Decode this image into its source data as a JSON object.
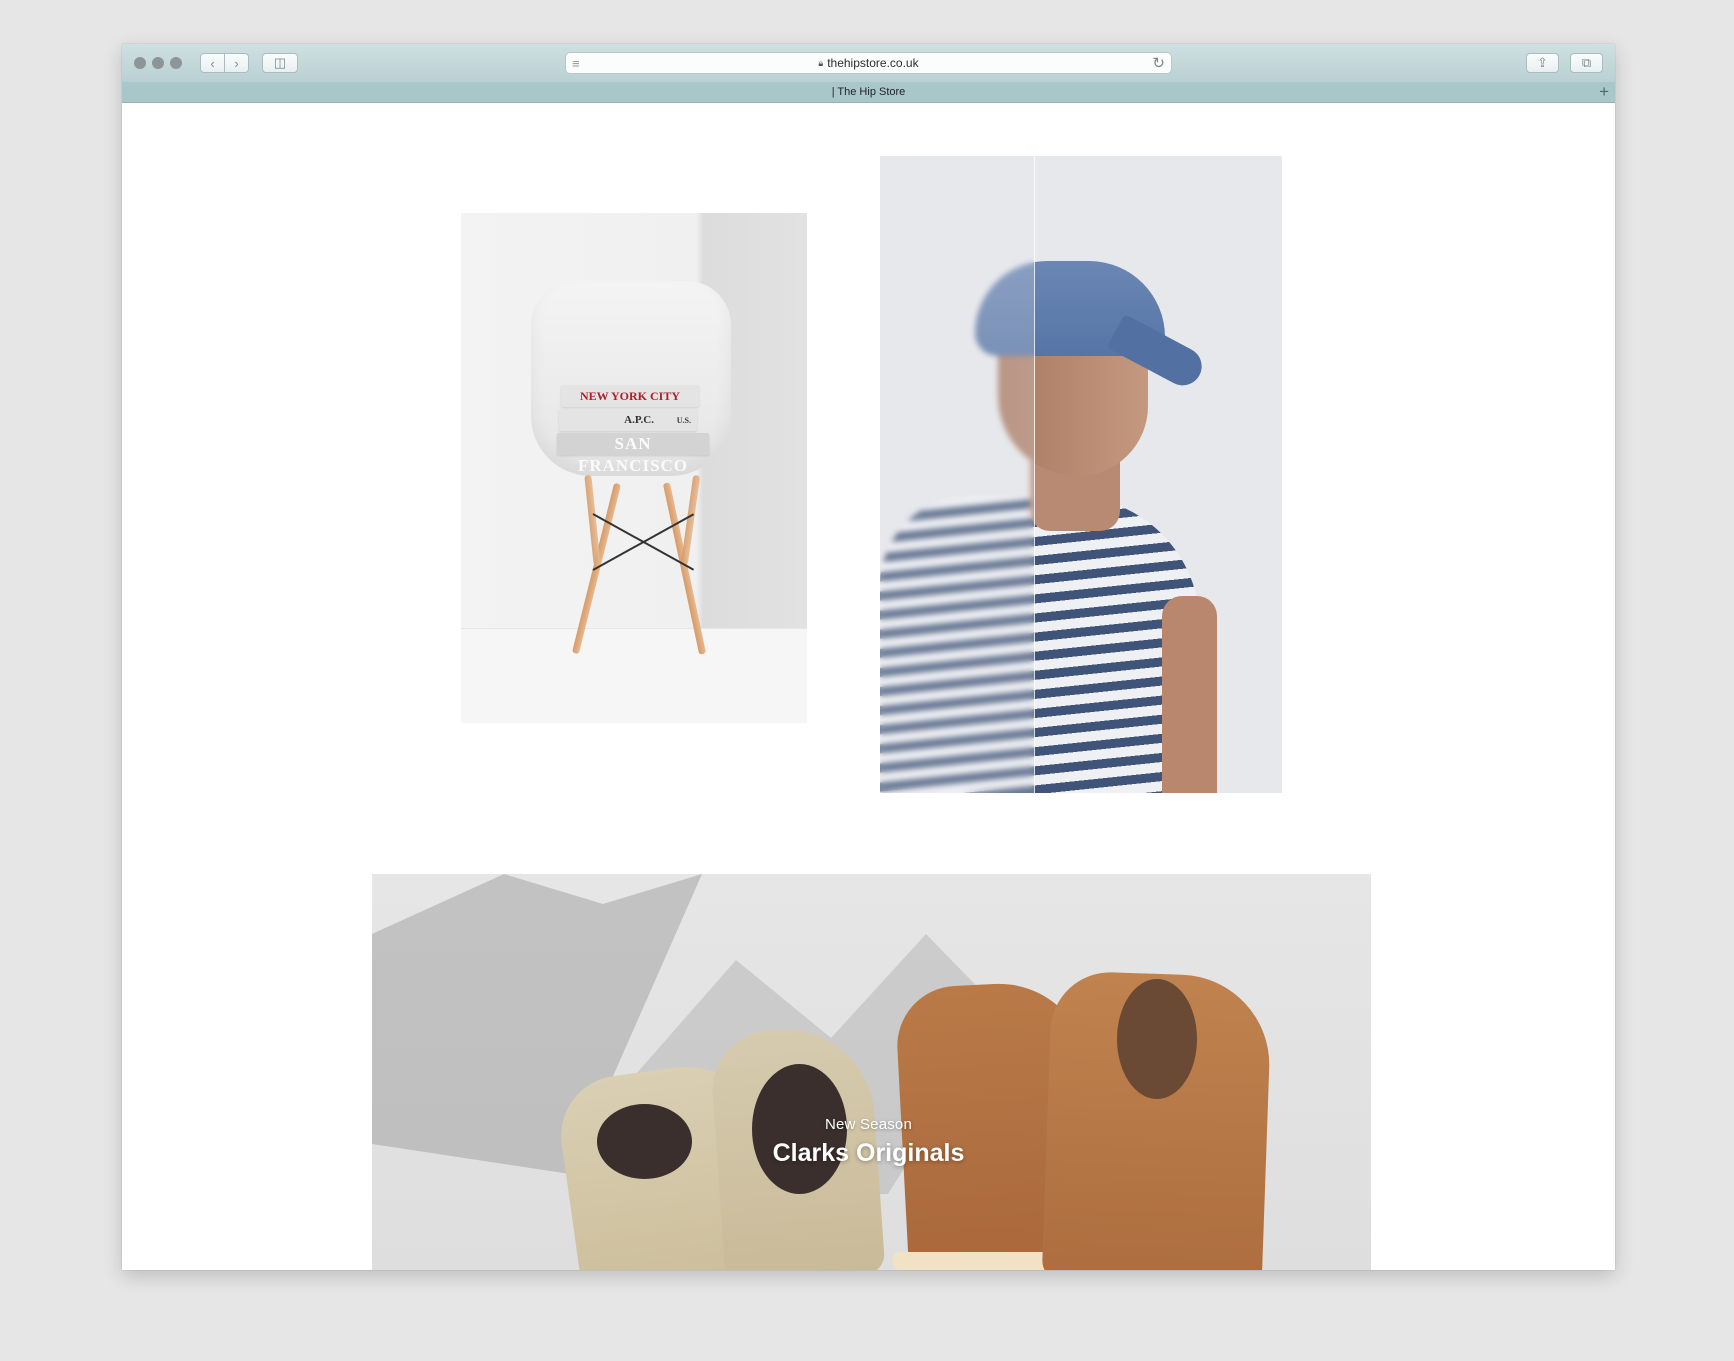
{
  "browser": {
    "url": "thehipstore.co.uk",
    "tab_title": "| The Hip Store",
    "back_icon": "chevron-left-icon",
    "forward_icon": "chevron-right-icon",
    "sidebar_icon": "sidebar-icon",
    "reload_icon": "reload-icon",
    "share_icon": "share-icon",
    "tabs_icon": "tabs-icon",
    "new_tab_icon": "plus-icon",
    "chrome_color": "#b9d0d2"
  },
  "gallery": {
    "chair_tees": [
      "NEW YORK CITY",
      "A.P.C.",
      "U.S.",
      "SAN FRANCISCO"
    ]
  },
  "banner": {
    "subtitle": "New Season",
    "title": "Clarks Originals"
  }
}
